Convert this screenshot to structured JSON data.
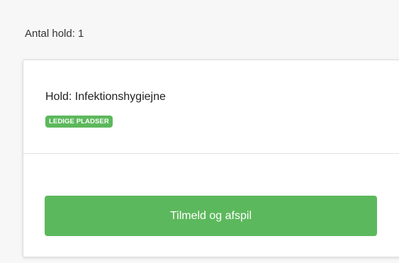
{
  "summary": {
    "team_count_label": "Antal hold: 1"
  },
  "card": {
    "title": "Hold: Infektionshygiejne",
    "badge": "LEDIGE PLADSER",
    "button_label": "Tilmeld og afspil"
  },
  "colors": {
    "accent_green": "#5cb85c",
    "page_background": "#f7f7f7",
    "card_background": "#ffffff"
  }
}
